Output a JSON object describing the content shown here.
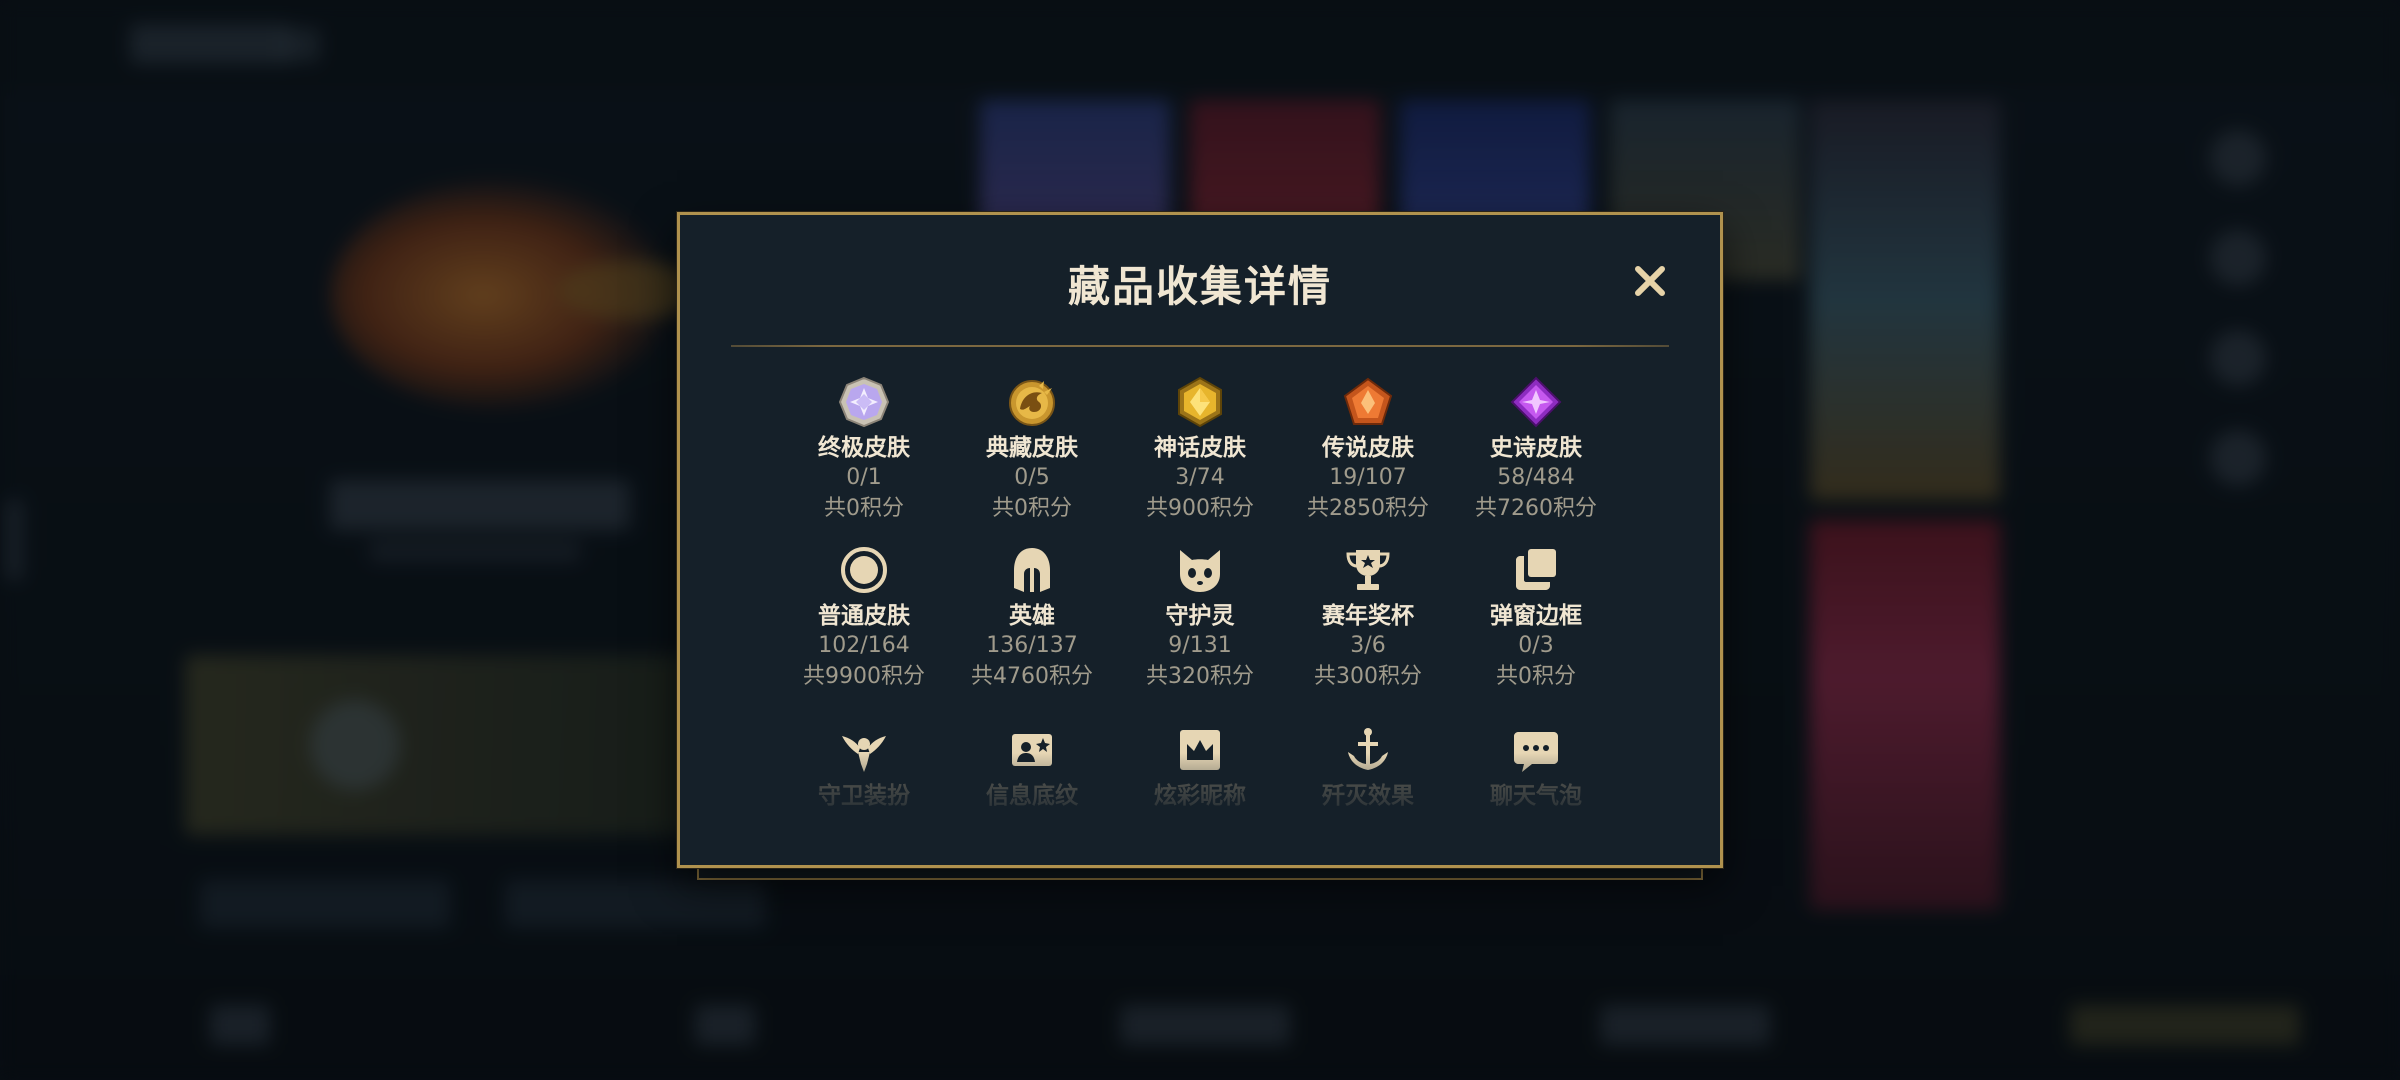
{
  "modal": {
    "title": "藏品收集详情"
  },
  "categories": [
    {
      "name": "终极皮肤",
      "count": "0/1",
      "points": "共0积分",
      "icon": "ultimate-skin-icon"
    },
    {
      "name": "典藏皮肤",
      "count": "0/5",
      "points": "共0积分",
      "icon": "exalted-skin-icon"
    },
    {
      "name": "神话皮肤",
      "count": "3/74",
      "points": "共900积分",
      "icon": "mythic-skin-icon"
    },
    {
      "name": "传说皮肤",
      "count": "19/107",
      "points": "共2850积分",
      "icon": "legendary-skin-icon"
    },
    {
      "name": "史诗皮肤",
      "count": "58/484",
      "points": "共7260积分",
      "icon": "epic-skin-icon"
    },
    {
      "name": "普通皮肤",
      "count": "102/164",
      "points": "共9900积分",
      "icon": "standard-skin-icon"
    },
    {
      "name": "英雄",
      "count": "136/137",
      "points": "共4760积分",
      "icon": "helmet-icon"
    },
    {
      "name": "守护灵",
      "count": "9/131",
      "points": "共320积分",
      "icon": "companion-icon"
    },
    {
      "name": "赛年奖杯",
      "count": "3/6",
      "points": "共300积分",
      "icon": "trophy-icon"
    },
    {
      "name": "弹窗边框",
      "count": "0/3",
      "points": "共0积分",
      "icon": "frame-icon"
    }
  ],
  "partial_row": [
    {
      "name": "守卫装扮",
      "icon": "ward-skin-icon"
    },
    {
      "name": "信息底纹",
      "icon": "banner-icon"
    },
    {
      "name": "炫彩昵称",
      "icon": "crown-icon"
    },
    {
      "name": "歼灭效果",
      "icon": "anchor-icon"
    },
    {
      "name": "聊天气泡",
      "icon": "chat-bubble-icon"
    }
  ],
  "colors": {
    "gold_border": "#b0924e",
    "title_text": "#f0e6d2",
    "muted_text": "#a09b8c",
    "panel_bg": "#152029"
  }
}
